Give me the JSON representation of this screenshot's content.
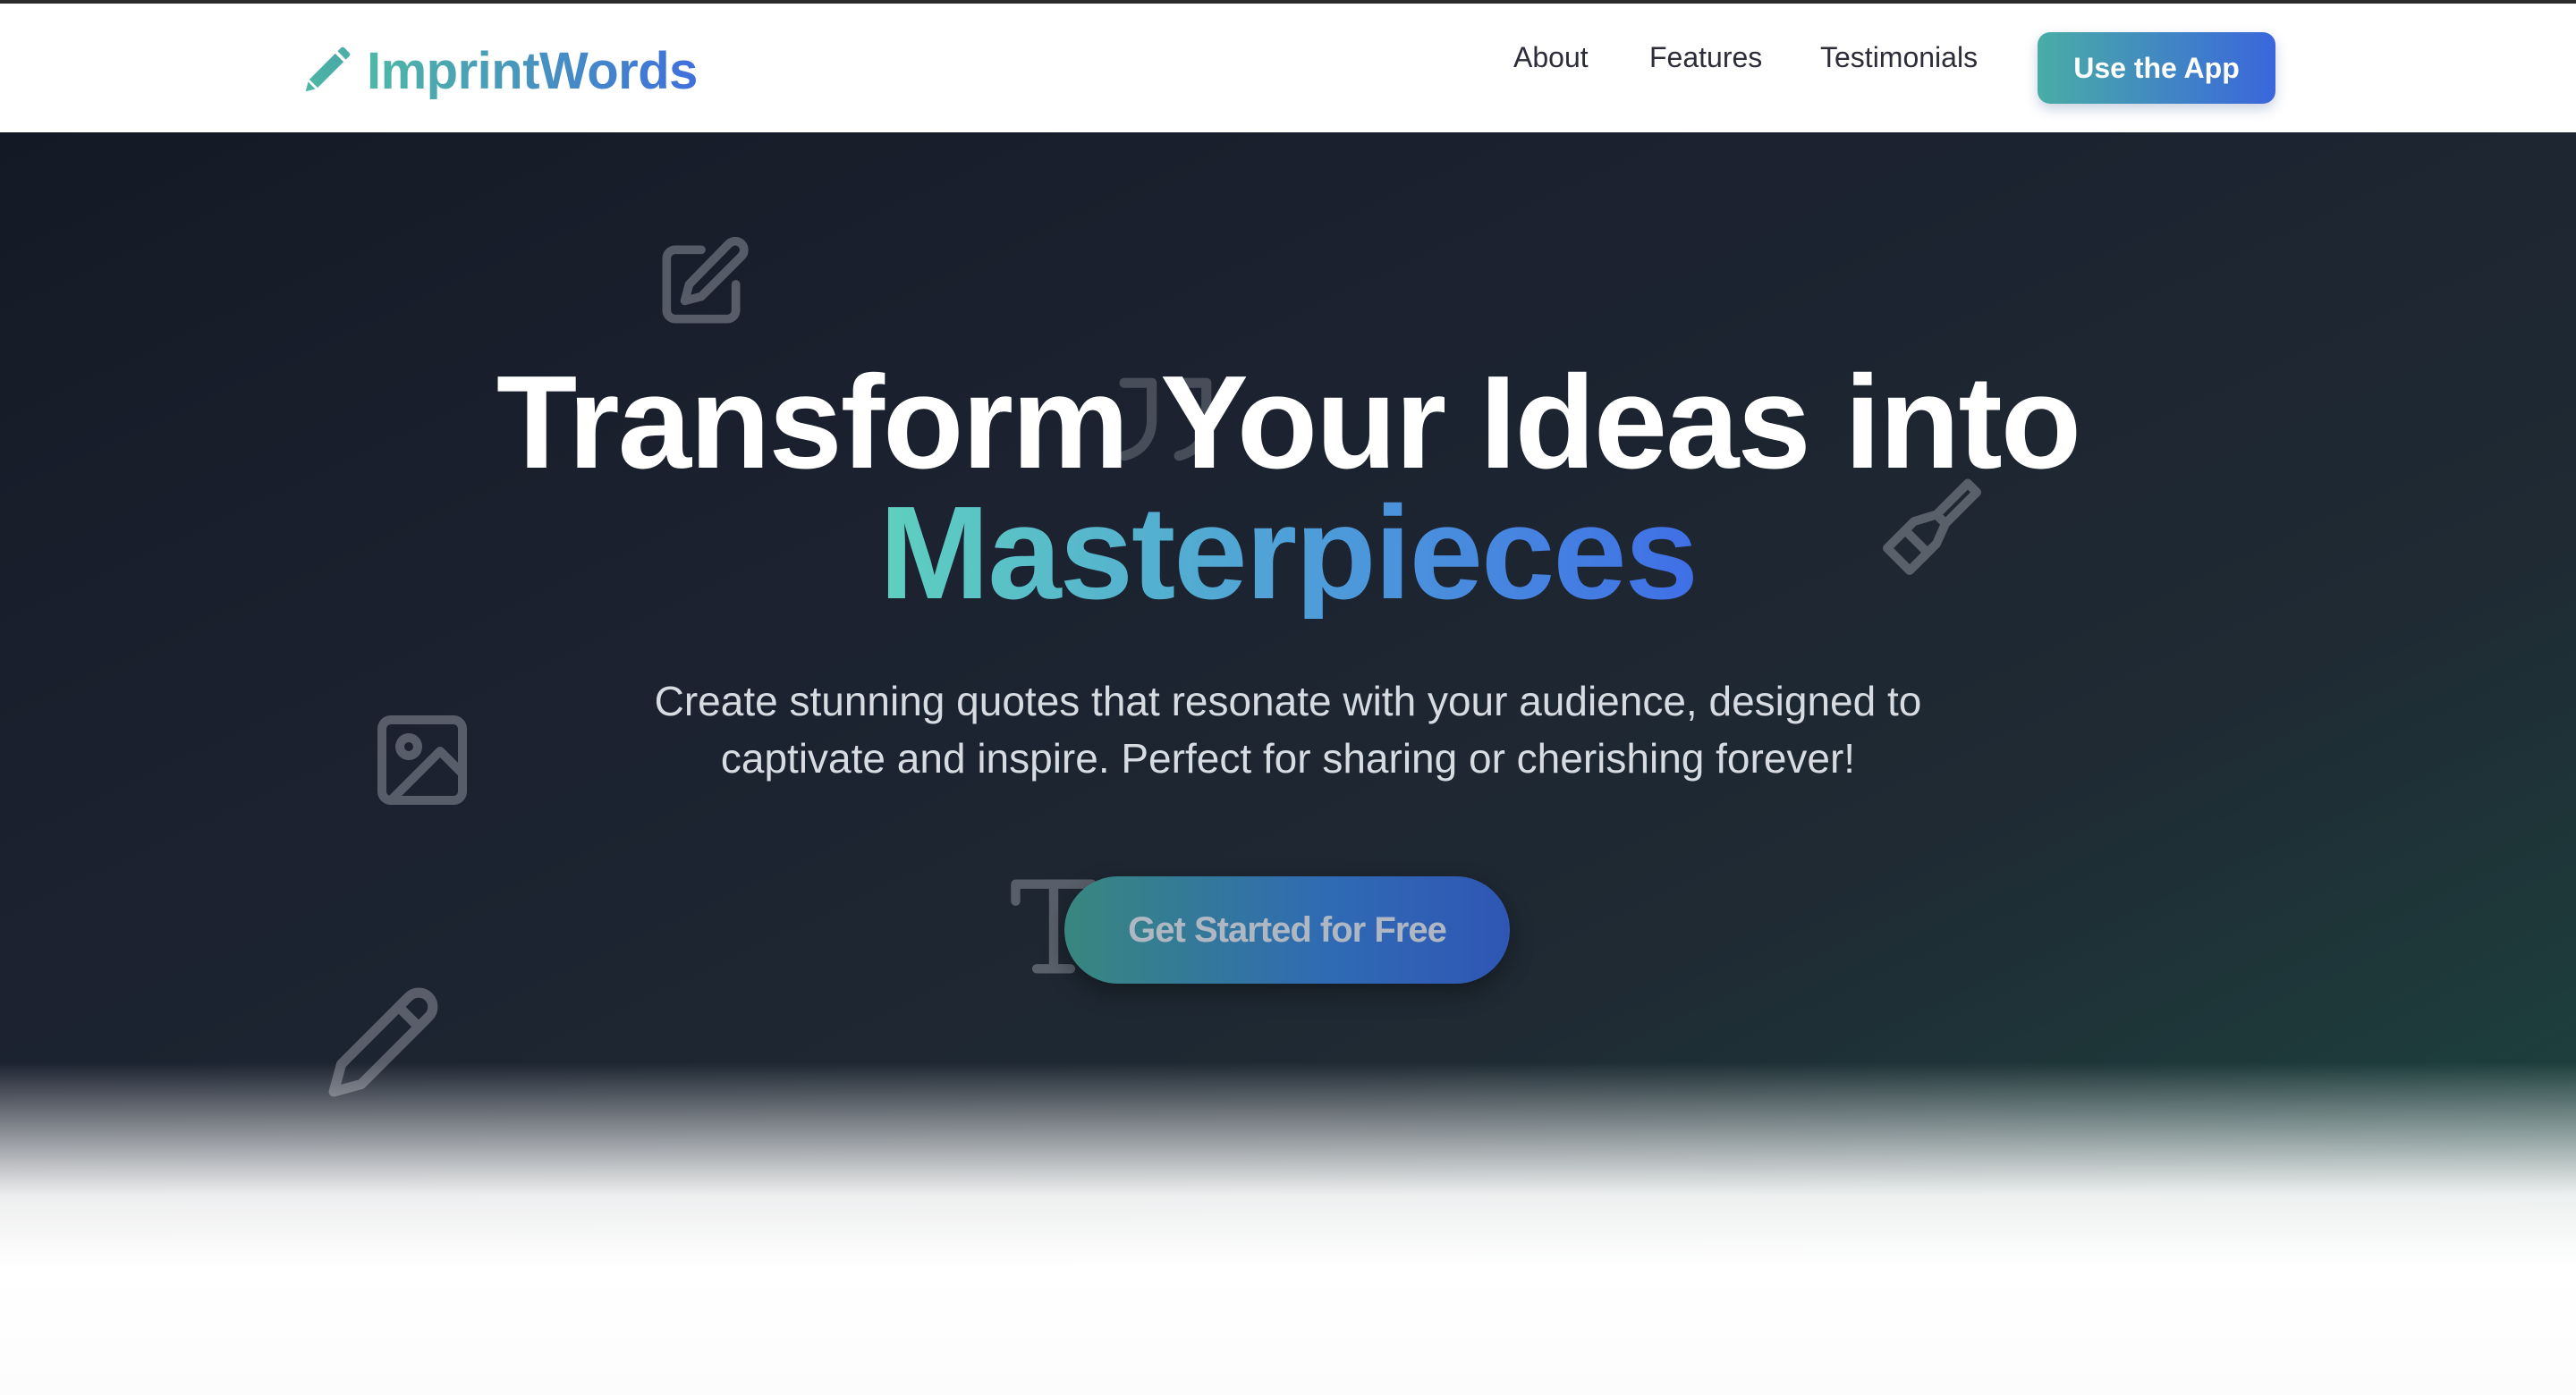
{
  "brand": {
    "name": "ImprintWords",
    "icon": "pencil-icon"
  },
  "nav": {
    "links": [
      {
        "label": "About"
      },
      {
        "label": "Features"
      },
      {
        "label": "Testimonials"
      }
    ],
    "cta_label": "Use the App"
  },
  "hero": {
    "title_line1": "Transform Your Ideas into",
    "title_line2": "Masterpieces",
    "subtitle_line1": "Create stunning quotes that resonate with your audience, designed to",
    "subtitle_line2": "captivate and inspire. Perfect for sharing or cherishing forever!",
    "cta_label": "Get Started for Free",
    "decorative_icons": [
      "edit-square-icon",
      "quote-icon",
      "paintbrush-icon",
      "image-icon",
      "text-type-icon",
      "pencil-icon"
    ]
  },
  "colors": {
    "brand_gradient_start": "#4fb8a4",
    "brand_gradient_end": "#3f6fdc",
    "hero_background": "#1c2230",
    "hero_accent": "#1c4b43"
  }
}
